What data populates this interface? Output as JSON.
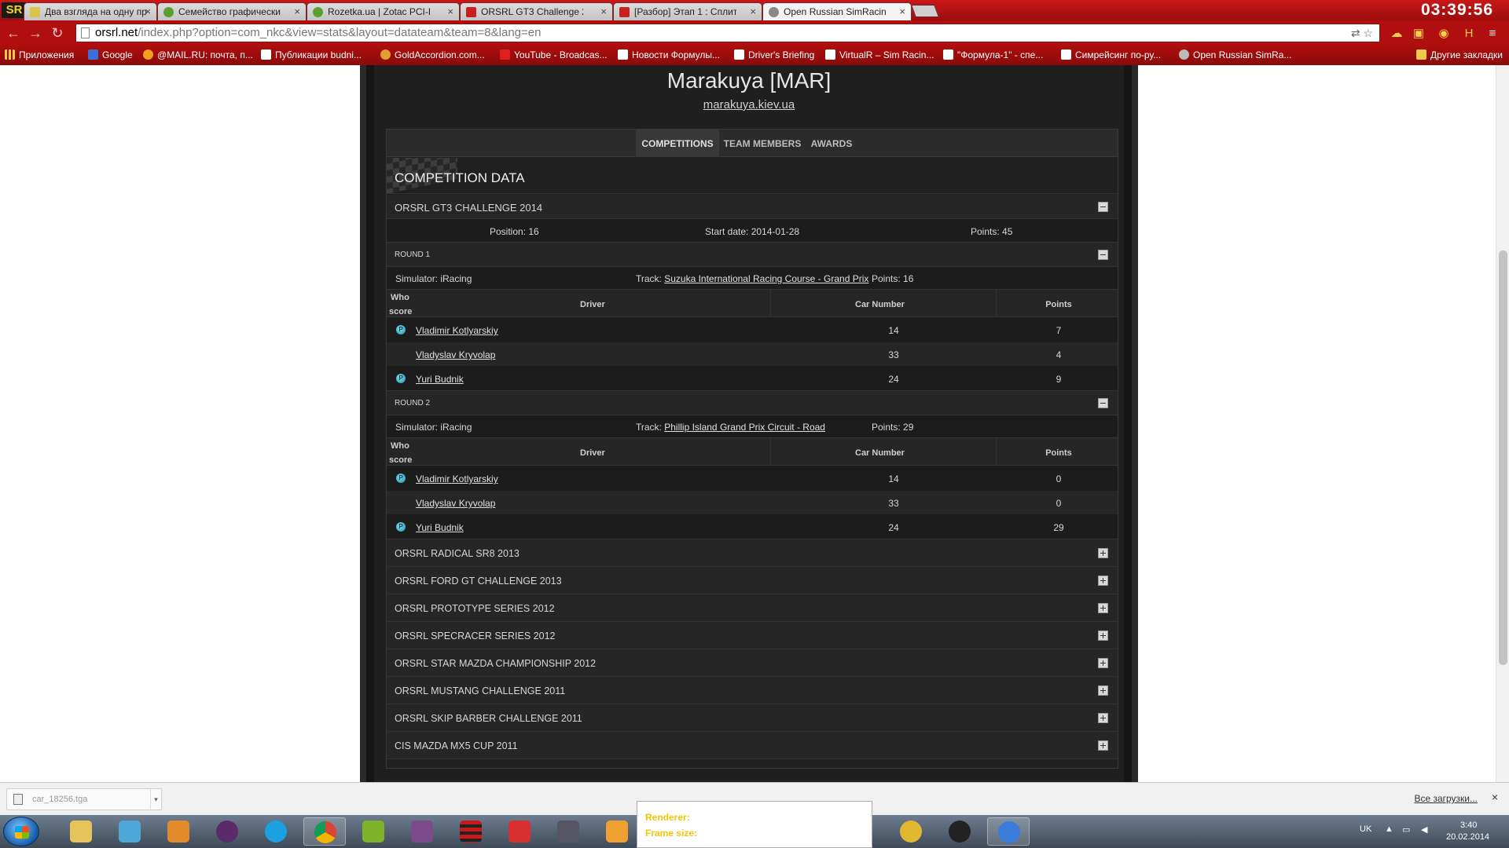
{
  "browser": {
    "tabs": [
      {
        "title": "Два взгляда на одну про...",
        "active": false
      },
      {
        "title": "Семейство графически...",
        "active": false
      },
      {
        "title": "Rozetka.ua | Zotac PCI-E...",
        "active": false
      },
      {
        "title": "ORSRL GT3 Challenge 20...",
        "active": false
      },
      {
        "title": "[Разбор] Этап 1 : Сплит 1...",
        "active": false
      },
      {
        "title": "Open Russian SimRacing",
        "active": true
      }
    ],
    "clock": "03:39:56",
    "url_host": "orsrl.net",
    "url_rest": "/index.php?option=com_nkc&view=stats&layout=datateam&team=8&lang=en",
    "bookmarks": [
      "Приложения",
      "Google",
      "@MAIL.RU: почта, п...",
      "Публикации budni...",
      "GoldAccordion.com...",
      "YouTube - Broadcas...",
      "Новости Формулы...",
      "Driver's Briefing",
      "VirtualR – Sim Racin...",
      "\"Формула-1\" - спе...",
      "Симрейсинг по-ру...",
      "Open Russian SimRa...",
      "Другие закладки"
    ]
  },
  "team": {
    "name": "Marakuya [MAR]",
    "website": "marakuya.kiev.ua"
  },
  "tabs": {
    "competitions": "COMPETITIONS",
    "team_members": "TEAM MEMBERS",
    "awards": "AWARDS"
  },
  "section_title": "COMPETITION DATA",
  "competition": {
    "title": "ORSRL GT3 CHALLENGE 2014",
    "position_label": "Position: 16",
    "start_label": "Start date: 2014-01-28",
    "points_label": "Points: 45"
  },
  "rounds": [
    {
      "title": "ROUND 1",
      "simulator": "Simulator: iRacing",
      "track_prefix": "Track: ",
      "track": "Suzuka International Racing Course - Grand Prix",
      "points": "Points: 16",
      "headers": {
        "who": "Who",
        "score": "score",
        "driver": "Driver",
        "car": "Car Number",
        "points": "Points"
      },
      "rows": [
        {
          "scored": true,
          "driver": "Vladimir Kotlyarskiy",
          "car": "14",
          "points": "7"
        },
        {
          "scored": false,
          "driver": "Vladyslav Kryvolap",
          "car": "33",
          "points": "4"
        },
        {
          "scored": true,
          "driver": "Yuri Budnik",
          "car": "24",
          "points": "9"
        }
      ]
    },
    {
      "title": "ROUND 2",
      "simulator": "Simulator: iRacing",
      "track_prefix": "Track: ",
      "track": "Phillip Island Grand Prix Circuit - Road",
      "points": "Points: 29",
      "headers": {
        "who": "Who",
        "score": "score",
        "driver": "Driver",
        "car": "Car Number",
        "points": "Points"
      },
      "rows": [
        {
          "scored": true,
          "driver": "Vladimir Kotlyarskiy",
          "car": "14",
          "points": "0"
        },
        {
          "scored": false,
          "driver": "Vladyslav Kryvolap",
          "car": "33",
          "points": "0"
        },
        {
          "scored": true,
          "driver": "Yuri Budnik",
          "car": "24",
          "points": "29"
        }
      ]
    }
  ],
  "score_icon_letter": "P",
  "other_competitions": [
    "ORSRL RADICAL SR8 2013",
    "ORSRL FORD GT CHALLENGE 2013",
    "ORSRL PROTOTYPE SERIES 2012",
    "ORSRL SPECRACER SERIES 2012",
    "ORSRL STAR MAZDA CHAMPIONSHIP 2012",
    "ORSRL MUSTANG CHALLENGE 2011",
    "ORSRL SKIP BARBER CHALLENGE 2011",
    "CIS MAZDA MX5 CUP 2011"
  ],
  "downloads": {
    "file": "car_18256.tga",
    "all": "Все загрузки...",
    "close": "×"
  },
  "popup": {
    "renderer": "Renderer:",
    "frame_size": "Frame size:"
  },
  "tray": {
    "lang": "UK",
    "time": "3:40",
    "date": "20.02.2014"
  },
  "colors": {
    "chrome_red": "#b10f0f",
    "site_bg": "#1f1f1f",
    "score_icon": "#3fb8cf"
  }
}
